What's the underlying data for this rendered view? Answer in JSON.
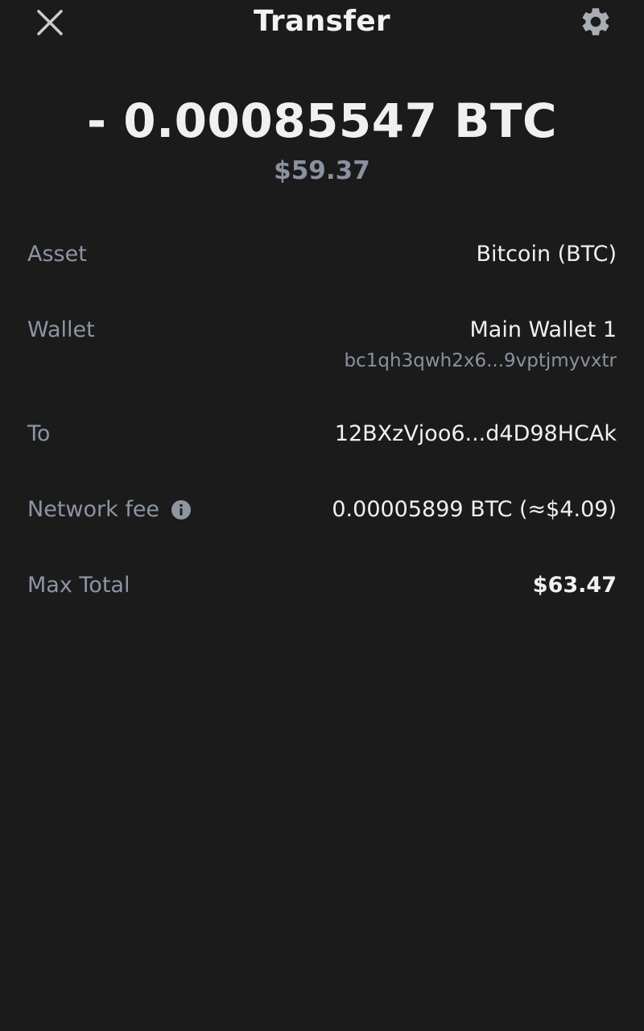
{
  "header": {
    "title": "Transfer",
    "close_icon": "close-icon",
    "settings_icon": "gear-icon"
  },
  "summary": {
    "amount": "- 0.00085547 BTC",
    "fiat": "$59.37"
  },
  "details": {
    "asset": {
      "label": "Asset",
      "value": "Bitcoin (BTC)"
    },
    "wallet": {
      "label": "Wallet",
      "value": "Main Wallet 1",
      "address": "bc1qh3qwh2x6...9vptjmyvxtr"
    },
    "to": {
      "label": "To",
      "value": "12BXzVjoo6...d4D98HCAk"
    },
    "fee": {
      "label": "Network fee",
      "value": "0.00005899 BTC (≈$4.09)",
      "icon": "info-icon"
    },
    "total": {
      "label": "Max Total",
      "value": "$63.47"
    }
  },
  "colors": {
    "background": "#1b1b1c",
    "primary_text": "#eef0f2",
    "secondary_text": "#8d95a3"
  }
}
